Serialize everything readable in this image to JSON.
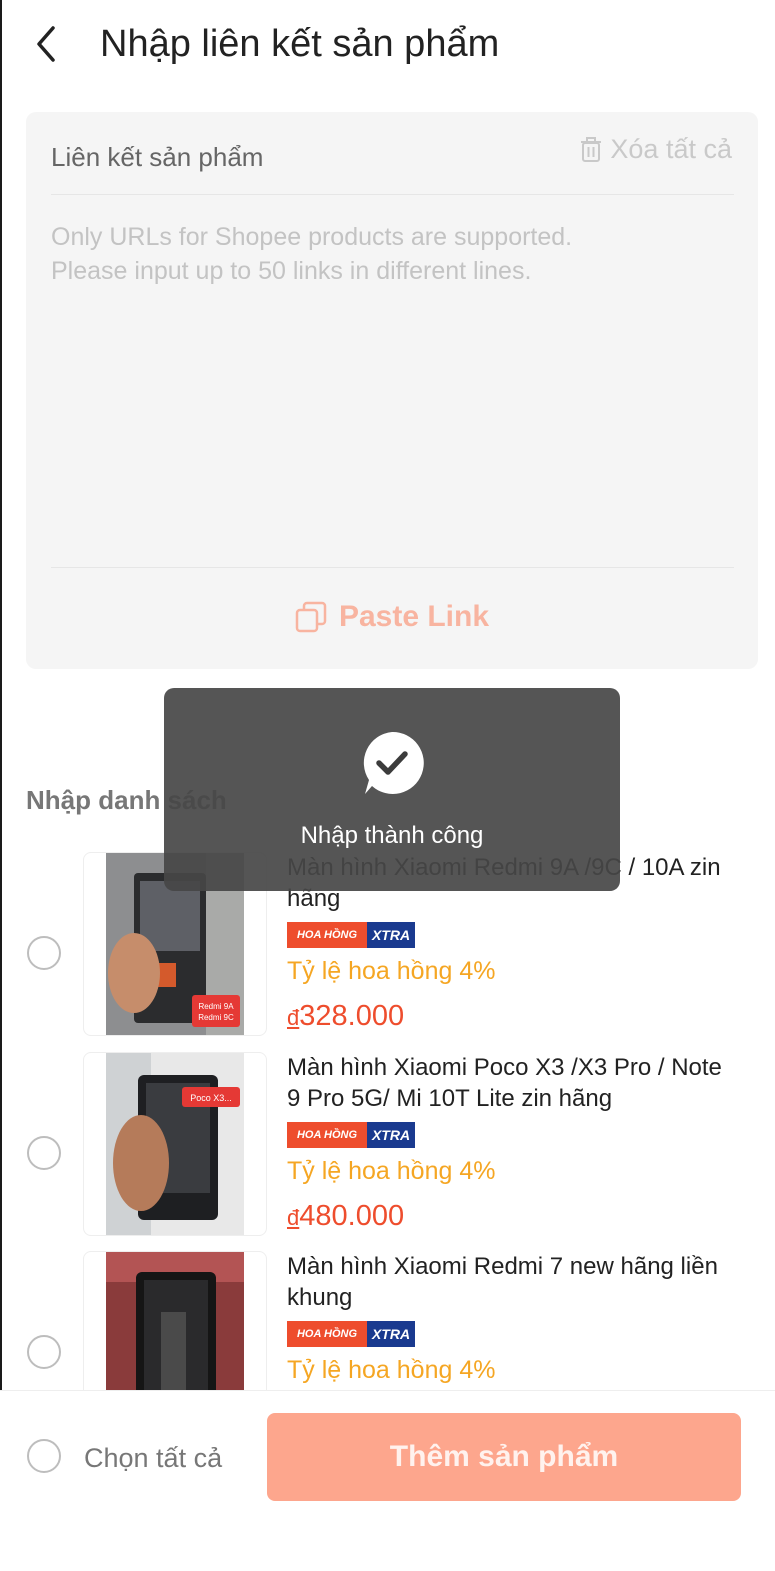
{
  "header": {
    "title": "Nhập liên kết sản phẩm"
  },
  "link_panel": {
    "label": "Liên kết sản phẩm",
    "clear_all": "Xóa tất cả",
    "placeholder": "Only URLs for Shopee products are supported.\nPlease input up to 50 links in different lines.",
    "paste_link": "Paste Link"
  },
  "section": {
    "title": "Nhập danh sách"
  },
  "products": [
    {
      "title": "Màn hình Xiaomi Redmi 9A /9C / 10A zin hãng",
      "badge_left": "HOA HỒNG",
      "badge_right": "XTRA",
      "commission": "Tỷ lệ hoa hồng 4%",
      "currency": "đ",
      "price": "328.000",
      "photo_label": "Redmi 9A Redmi 9C"
    },
    {
      "title": "Màn hình Xiaomi Poco X3 /X3 Pro / Note 9 Pro 5G/ Mi 10T Lite zin hãng",
      "badge_left": "HOA HỒNG",
      "badge_right": "XTRA",
      "commission": "Tỷ lệ hoa hồng 4%",
      "currency": "đ",
      "price": "480.000",
      "photo_label": "Poco X3..."
    },
    {
      "title": "Màn hình Xiaomi Redmi  7 new hãng liền khung",
      "badge_left": "HOA HỒNG",
      "badge_right": "XTRA",
      "commission": "Tỷ lệ hoa hồng 4%"
    }
  ],
  "toast": {
    "message": "Nhập thành công"
  },
  "bottom_bar": {
    "select_all": "Chọn tất cả",
    "add_button": "Thêm sản phẩm"
  },
  "colors": {
    "accent": "#ee4d2d",
    "commission": "#f5a623",
    "button_disabled": "#fda68d"
  }
}
